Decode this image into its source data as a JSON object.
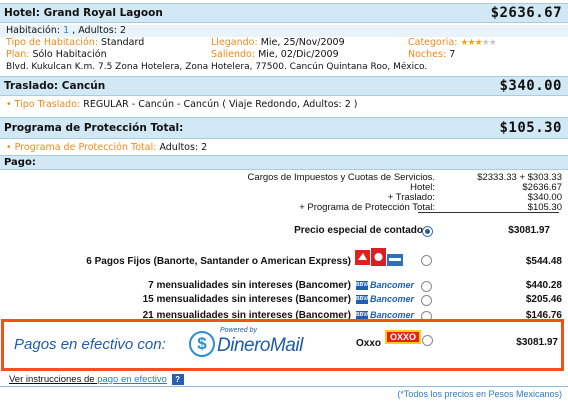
{
  "hotel": {
    "title": "Hotel: Grand Royal Lagoon",
    "amount": "$2636.67",
    "room_label": "Habitación: ",
    "room_count": "1",
    "adults": " , Adultos: 2",
    "room_type_label": "Tipo de Habitación: ",
    "room_type": "Standard",
    "arrival_label": "Llegando: ",
    "arrival": "Mie, 25/Nov/2009",
    "category_label": "Categoria: ",
    "stars": 3,
    "stars_total": 5,
    "plan_label": "Plan: ",
    "plan": "Sólo Habitación",
    "departure_label": "Saliendo: ",
    "departure": "Mie, 02/Dic/2009",
    "nights_label": "Noches: ",
    "nights": "7",
    "address": "Blvd. Kukulcan K.m. 7.5 Zona Hotelera, Zona Hotelera, 77500. Cancún Quintana Roo, México."
  },
  "transfer": {
    "title": "Traslado: Cancún",
    "amount": "$340.00",
    "type_label": "Tipo Traslado: ",
    "type_value": "REGULAR - Cancún - Cancún ( Viaje Redondo, Adultos: 2 )"
  },
  "protection": {
    "title": "Programa de Protección Total:",
    "amount": "$105.30",
    "label": "Programa de Protección Total: ",
    "value": "Adultos: 2"
  },
  "payment": {
    "title": "Pago:",
    "charges": [
      {
        "label": "Cargos de Impuestos y Cuotas de Servicios.",
        "value": "$2333.33 + $303.33"
      },
      {
        "label": "Hotel:",
        "value": "$2636.67"
      },
      {
        "label": "+ Traslado:",
        "value": "$340.00"
      },
      {
        "label": "+ Programa de Protección Total:",
        "value": "$105.30"
      }
    ],
    "cash_label": "Precio especial de contado",
    "cash_amount": "$3081.97",
    "options": [
      {
        "label": "6 Pagos Fijos (Banorte, Santander o American Express)",
        "amount": "$544.48"
      },
      {
        "label": "7 mensualidades sin intereses (Bancomer)",
        "amount": "$440.28",
        "bank": "Bancomer"
      },
      {
        "label": "15 mensualidades sin intereses (Bancomer)",
        "amount": "$205.46",
        "bank": "Bancomer"
      },
      {
        "label": "21 mensualidades sin intereses (Bancomer)",
        "amount": "$146.76",
        "bank": "Bancomer"
      }
    ],
    "bank_badge": "BBVA",
    "dineromail": {
      "prefix": "Pagos en efectivo con:",
      "powered_by": "Powered by",
      "brand": "DineroMail",
      "store": "Oxxo",
      "store_logo": "OXXO",
      "amount": "$3081.97"
    },
    "instructions_prefix": "Ver instrucciones de ",
    "instructions_link": "pago en efectivo",
    "footnote": "(*Todos los precios en Pesos Mexicanos)"
  }
}
